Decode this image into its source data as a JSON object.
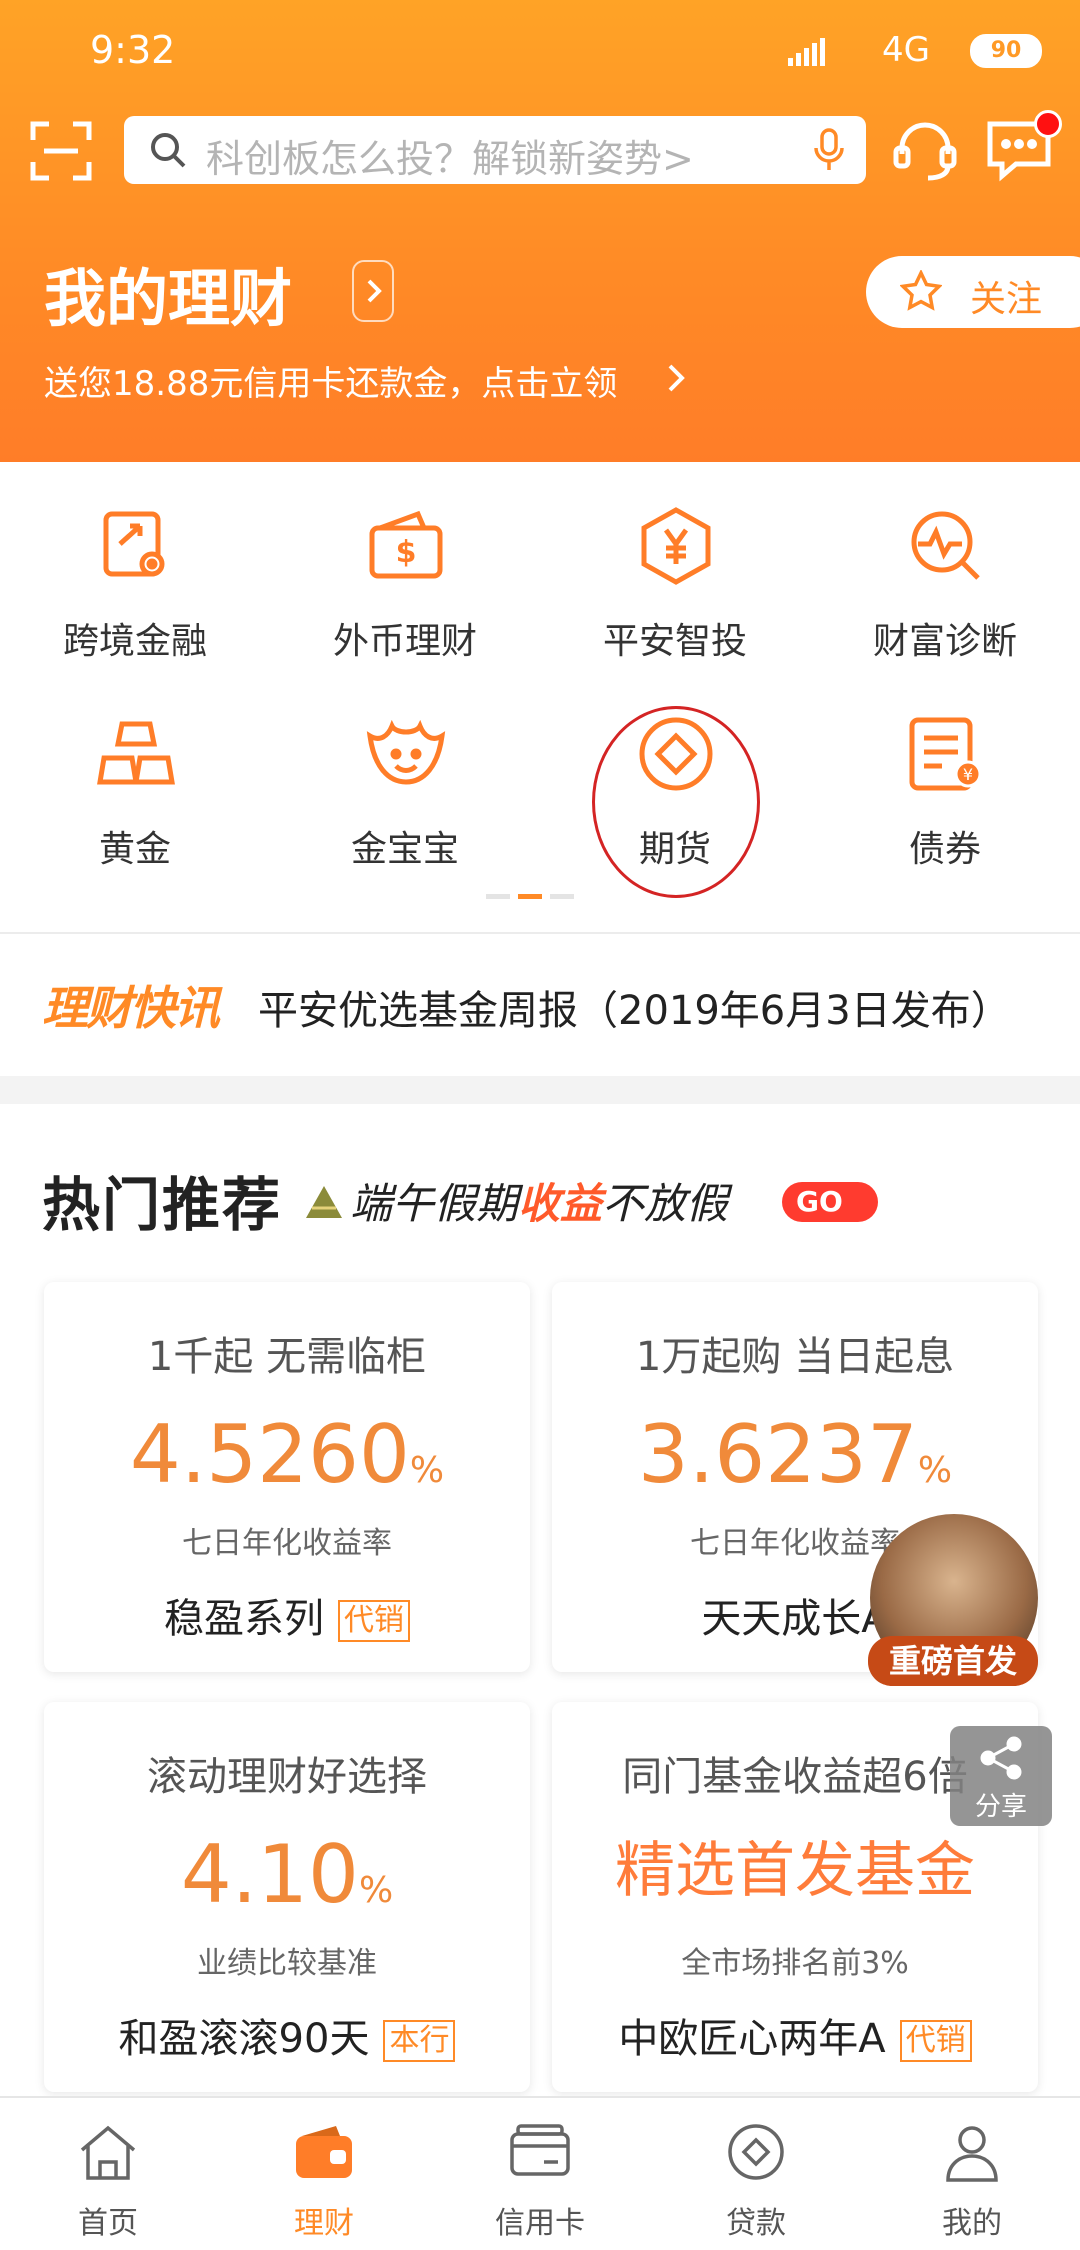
{
  "status_bar": {
    "time": "9:32",
    "network": "4G",
    "battery": "90"
  },
  "search": {
    "placeholder": "科创板怎么投？解锁新姿势>"
  },
  "header": {
    "title": "我的理财",
    "follow_label": "关注",
    "promo_text": "送您18.88元信用卡还款金，点击立领"
  },
  "grid": {
    "items": [
      {
        "label": "跨境金融",
        "icon": "crossborder-icon"
      },
      {
        "label": "外币理财",
        "icon": "dollar-wallet-icon"
      },
      {
        "label": "平安智投",
        "icon": "yuan-hexagon-icon"
      },
      {
        "label": "财富诊断",
        "icon": "diagnosis-icon"
      },
      {
        "label": "黄金",
        "icon": "gold-bars-icon"
      },
      {
        "label": "金宝宝",
        "icon": "ingot-smile-icon"
      },
      {
        "label": "期货",
        "icon": "futures-icon"
      },
      {
        "label": "债券",
        "icon": "bond-document-icon"
      }
    ],
    "page_index": 1,
    "page_count": 3
  },
  "news": {
    "tag": "理财快讯",
    "text": "平安优选基金周报（2019年6月3日发布）"
  },
  "recommend": {
    "title": "热门推荐",
    "promo_part1": "端午假期",
    "promo_highlight": "收益",
    "promo_part2": "不放假",
    "go_label": "GO",
    "cards": [
      {
        "top": "1千起 无需临柜",
        "value": "4.5260",
        "unit": "%",
        "sub": "七日年化收益率",
        "name": "稳盈系列",
        "badge": "代销"
      },
      {
        "top": "1万起购 当日起息",
        "value": "3.6237",
        "unit": "%",
        "sub": "七日年化收益率",
        "name": "天天成长A",
        "badge": ""
      },
      {
        "top": "滚动理财好选择",
        "value": "4.10",
        "unit": "%",
        "sub": "业绩比较基准",
        "name": "和盈滚滚90天",
        "badge": "本行"
      },
      {
        "top": "同门基金收益超6倍",
        "big": "精选首发基金",
        "sub": "全市场排名前3%",
        "name": "中欧匠心两年A",
        "badge": "代销"
      }
    ]
  },
  "advisor": {
    "tag": "重磅首发"
  },
  "share": {
    "label": "分享"
  },
  "nav": {
    "items": [
      {
        "label": "首页"
      },
      {
        "label": "理财"
      },
      {
        "label": "信用卡"
      },
      {
        "label": "贷款"
      },
      {
        "label": "我的"
      }
    ],
    "active_index": 1
  },
  "colors": {
    "brand": "#ff8a26",
    "value_orange": "#f08a3a",
    "annotation_red": "#d42424"
  }
}
